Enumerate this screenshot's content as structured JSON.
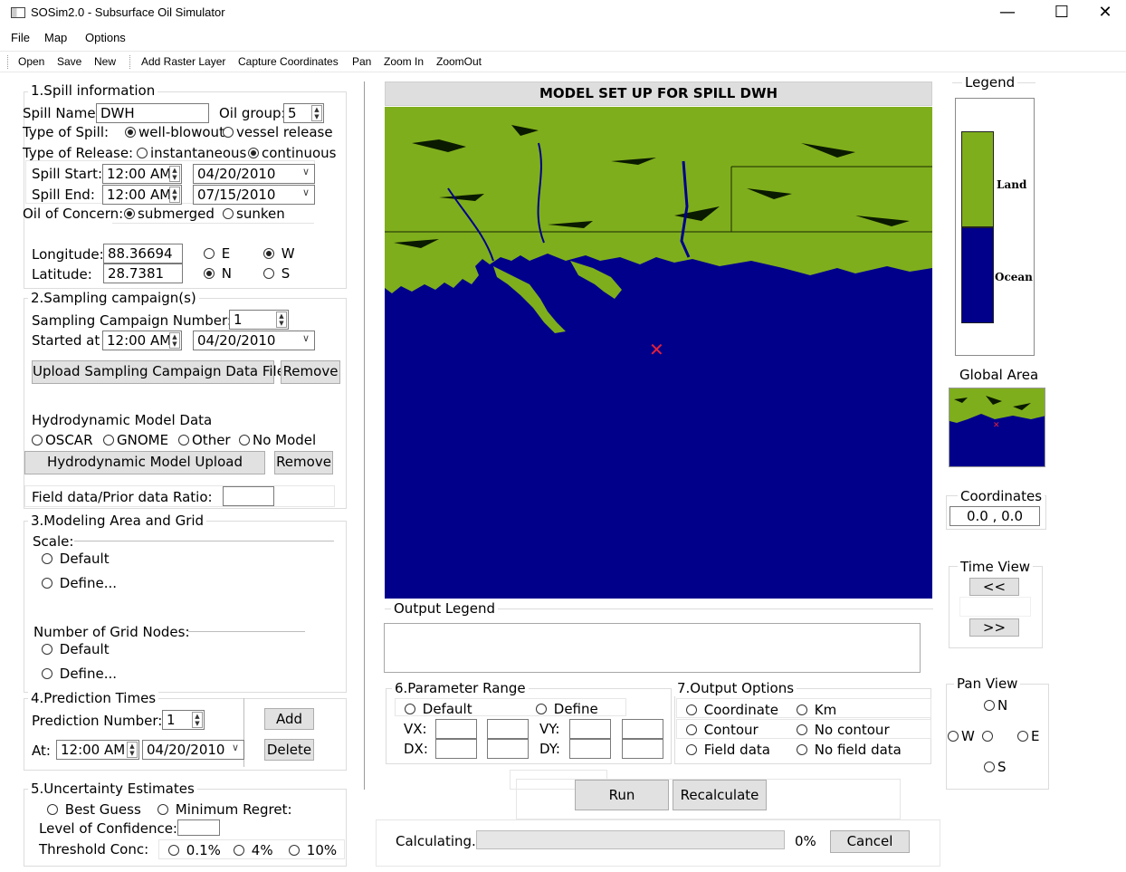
{
  "window": {
    "title": "SOSim2.0 - Subsurface Oil Simulator",
    "minimize": "—",
    "maximize": "☐",
    "close": "✕"
  },
  "menu": [
    "File",
    "Map",
    "Options"
  ],
  "toolbar": [
    "Open",
    "Save",
    "New",
    "Add Raster Layer",
    "Capture Coordinates",
    "Pan",
    "Zoom In",
    "ZoomOut"
  ],
  "spill": {
    "section_title": "1.Spill information",
    "name_label": "Spill Name:",
    "name_value": "DWH",
    "oil_group_label": "Oil group:",
    "oil_group_value": "5",
    "type_label": "Type of Spill:",
    "type_options": [
      "well-blowout",
      "vessel release"
    ],
    "release_label": "Type of Release:",
    "release_options": [
      "instantaneous",
      "continuous"
    ],
    "start_label": "Spill Start:",
    "start_time": "12:00 AM",
    "start_date": "04/20/2010",
    "end_label": "Spill End:",
    "end_time": "12:00 AM",
    "end_date": "07/15/2010",
    "concern_label": "Oil of Concern:",
    "concern_options": [
      "submerged",
      "sunken"
    ],
    "lon_label": "Longitude:",
    "lon_value": "88.36694",
    "lat_label": "Latitude:",
    "lat_value": "28.7381",
    "ew": [
      "E",
      "W"
    ],
    "ns": [
      "N",
      "S"
    ]
  },
  "sampling": {
    "section_title": "2.Sampling campaign(s)",
    "number_label": "Sampling Campaign Number:",
    "number_value": "1",
    "started_label": "Started at",
    "started_time": "12:00 AM",
    "started_date": "04/20/2010",
    "upload_button": "Upload Sampling Campaign Data File",
    "remove_button": "Remove",
    "hydro_label": "Hydrodynamic Model Data",
    "hydro_options": [
      "OSCAR",
      "GNOME",
      "Other",
      "No Model"
    ],
    "hydro_upload_button": "Hydrodynamic Model Upload",
    "hydro_remove_button": "Remove",
    "ratio_label": "Field data/Prior data Ratio:"
  },
  "grid": {
    "section_title": "3.Modeling Area and Grid",
    "scale_label": "Scale:",
    "scale_options": [
      "Default",
      "Define..."
    ],
    "nodes_label": "Number of Grid Nodes:",
    "nodes_options": [
      "Default",
      "Define..."
    ]
  },
  "prediction": {
    "section_title": "4.Prediction Times",
    "number_label": "Prediction Number:",
    "number_value": "1",
    "at_label": "At:",
    "at_time": "12:00 AM",
    "at_date": "04/20/2010",
    "add_button": "Add",
    "delete_button": "Delete"
  },
  "uncertainty": {
    "section_title": "5.Uncertainty Estimates",
    "options": [
      "Best Guess",
      "Minimum Regret:"
    ],
    "confidence_label": "Level of Confidence:",
    "threshold_label": "Threshold Conc:",
    "threshold_options": [
      "0.1%",
      "4%",
      "10%"
    ]
  },
  "map": {
    "title": "MODEL SET UP FOR SPILL DWH",
    "spill_marker": "✕",
    "colors": {
      "land": "#7fae1c",
      "ocean": "#00008b",
      "marker": "#e5203a"
    }
  },
  "output_legend_label": "Output Legend",
  "parameter_range": {
    "section_title": "6.Parameter Range",
    "options": [
      "Default",
      "Define"
    ],
    "vx_label": "VX:",
    "vy_label": "VY:",
    "dx_label": "DX:",
    "dy_label": "DY:"
  },
  "output_options": {
    "section_title": "7.Output Options",
    "row1": [
      "Coordinate",
      "Km"
    ],
    "row2": [
      "Contour",
      "No contour"
    ],
    "row3": [
      "Field data",
      "No field data"
    ]
  },
  "run_button": "Run",
  "recalculate_button": "Recalculate",
  "progress": {
    "label": "Calculating...",
    "percent_text": "0%",
    "fraction": 0,
    "cancel_button": "Cancel"
  },
  "legend": {
    "title": "Legend",
    "land": "Land",
    "ocean": "Ocean"
  },
  "global_area_title": "Global Area",
  "coordinates": {
    "title": "Coordinates",
    "value": "0.0 ,  0.0"
  },
  "time_view": {
    "title": "Time View",
    "back_button": "<<",
    "forward_button": ">>"
  },
  "pan_view": {
    "title": "Pan View",
    "n": "N",
    "w": "W",
    "e": "E",
    "s": "S"
  }
}
